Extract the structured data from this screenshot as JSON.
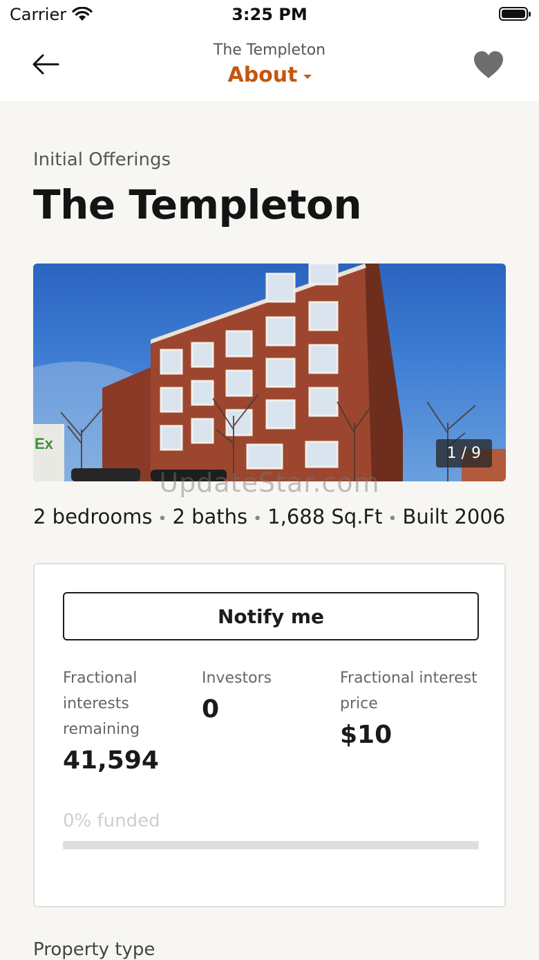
{
  "status_bar": {
    "carrier": "Carrier",
    "time": "3:25 PM"
  },
  "nav": {
    "subtitle": "The Templeton",
    "title": "About",
    "back_icon": "arrow-left-icon",
    "favorite_icon": "heart-icon"
  },
  "header": {
    "eyebrow": "Initial Offerings",
    "title": "The Templeton"
  },
  "gallery": {
    "counter": "1 / 9",
    "watermark": "UpdateStar.com"
  },
  "facts": {
    "bedrooms": "2 bedrooms",
    "baths": "2 baths",
    "sqft": "1,688 Sq.Ft",
    "built": "Built 2006",
    "separator": "•"
  },
  "offering": {
    "notify_label": "Notify me",
    "stats": [
      {
        "label": "Fractional interests remaining",
        "value": "41,594"
      },
      {
        "label": "Investors",
        "value": "0"
      },
      {
        "label": "Fractional interest price",
        "value": "$10"
      }
    ],
    "funded_label": "0% funded",
    "funded_fraction": 0
  },
  "sections": {
    "property_type_label": "Property type"
  },
  "colors": {
    "accent": "#c4560d",
    "background": "#f7f6f3",
    "heart": "#6e6e6e"
  }
}
